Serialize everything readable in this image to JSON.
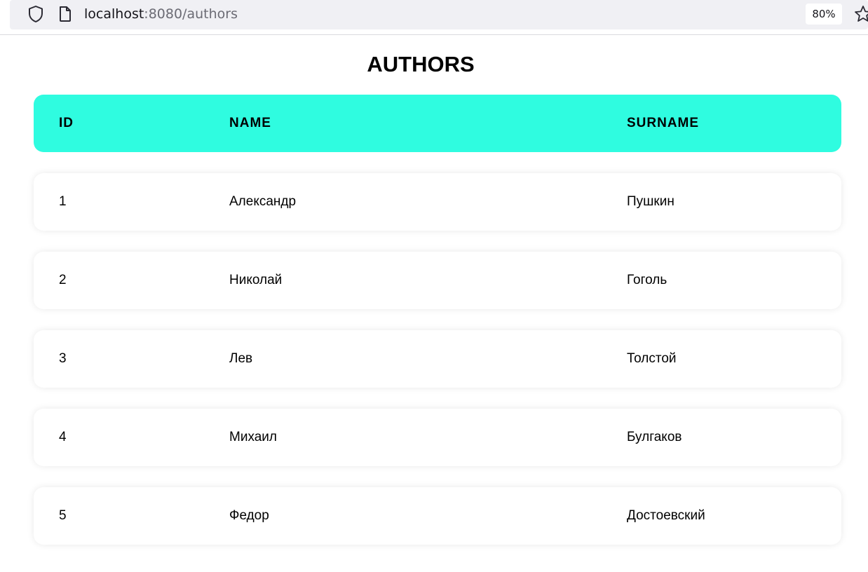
{
  "browser": {
    "url_host": "localhost",
    "url_rest": ":8080/authors",
    "zoom": "80%"
  },
  "page": {
    "title": "AUTHORS"
  },
  "table": {
    "headers": {
      "id": "ID",
      "name": "NAME",
      "surname": "SURNAME"
    },
    "header_color": "#2ffce0",
    "rows": [
      {
        "id": "1",
        "name": "Александр",
        "surname": "Пушкин"
      },
      {
        "id": "2",
        "name": "Николай",
        "surname": "Гоголь"
      },
      {
        "id": "3",
        "name": "Лев",
        "surname": "Толстой"
      },
      {
        "id": "4",
        "name": "Михаил",
        "surname": "Булгаков"
      },
      {
        "id": "5",
        "name": "Федор",
        "surname": "Достоевский"
      }
    ]
  },
  "icons": [
    "shield-icon",
    "page-icon",
    "star-icon"
  ]
}
